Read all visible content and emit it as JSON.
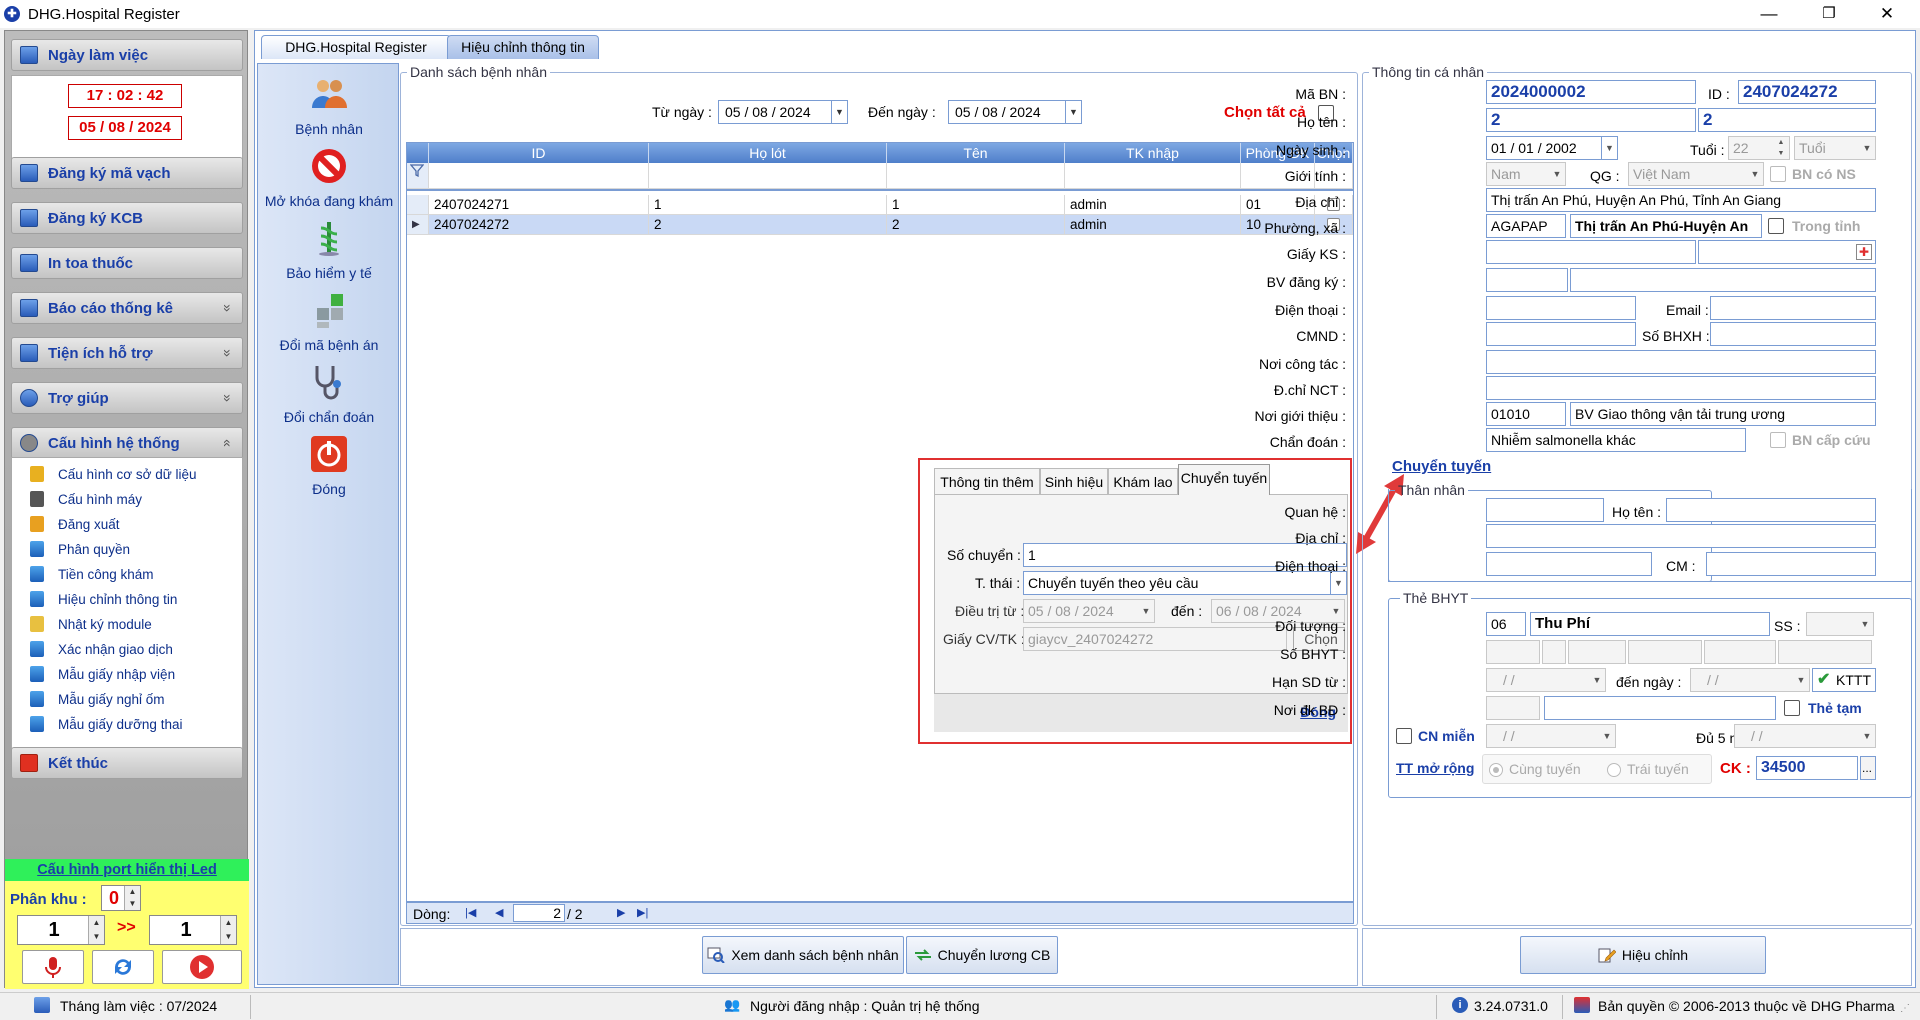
{
  "window": {
    "title": "DHG.Hospital Register",
    "minimize": "—",
    "restore": "❐",
    "close": "✕"
  },
  "sidebar": {
    "ngay_lam_viec": "Ngày làm việc",
    "time": "17 : 02 : 42",
    "date": "05 / 08 / 2024",
    "sections": [
      {
        "label": "Đăng ký mã vạch"
      },
      {
        "label": "Đăng ký KCB"
      },
      {
        "label": "In toa thuốc"
      },
      {
        "label": "Báo cáo thống kê",
        "chev": "»"
      },
      {
        "label": "Tiện ích hỗ trợ",
        "chev": "»"
      },
      {
        "label": "Trợ giúp",
        "chev": "»"
      },
      {
        "label": "Cấu hình hệ thống",
        "chev": "«"
      }
    ],
    "config_items": [
      "Cấu hình cơ sở dữ liệu",
      "Cấu hình máy",
      "Đăng xuất",
      "Phân quyền",
      "Tiền công khám",
      "Hiệu chỉnh thông tin",
      "Nhật ký module",
      "Xác nhận giao dịch",
      "Mẫu giấy nhập viện",
      "Mẫu giấy nghỉ ốm",
      "Mẫu giấy dưỡng thai"
    ],
    "ket_thuc": "Kết thúc",
    "led": {
      "title": "Cấu hình port hiển thị Led",
      "phan_khu_label": "Phân khu :",
      "phan_khu_value": "0",
      "left_value": "1",
      "arrow": ">>",
      "right_value": "1"
    }
  },
  "tabs": [
    "DHG.Hospital Register",
    "Hiệu chỉnh thông tin"
  ],
  "tools": [
    "Bệnh nhân",
    "Mở khóa đang khám",
    "Bảo hiểm y tế",
    "Đổi mã bệnh án",
    "Đổi chẩn đoán",
    "Đóng"
  ],
  "patient_list": {
    "legend": "Danh sách bệnh nhân",
    "tu_ngay_label": "Từ ngày :",
    "tu_ngay": "05 / 08 / 2024",
    "den_ngay_label": "Đến  ngày :",
    "den_ngay": "05 / 08 / 2024",
    "chon_tat_ca": "Chọn tất cả",
    "columns": [
      "ID",
      "Họ lót",
      "Tên",
      "TK nhập",
      "Phòng ĐK",
      "Chọn"
    ],
    "rows": [
      {
        "id": "2407024271",
        "ho_lot": "1",
        "ten": "1",
        "tk": "admin",
        "phong": "01"
      },
      {
        "id": "2407024272",
        "ho_lot": "2",
        "ten": "2",
        "tk": "admin",
        "phong": "10"
      }
    ],
    "footer": {
      "dong_label": "Dòng:",
      "current": "2",
      "total": "/   2"
    },
    "btn_xem": "Xem danh sách bệnh nhân",
    "btn_chuyen": "Chuyển lương CB"
  },
  "popup": {
    "tabs": [
      "Thông tin thêm",
      "Sinh hiệu",
      "Khám lao",
      "Chuyển tuyến"
    ],
    "so_chuyen_label": "Số chuyển :",
    "so_chuyen": "1",
    "t_thai_label": "T. thái :",
    "t_thai": "Chuyển tuyến theo yêu cầu",
    "dieu_tri_tu_label": "Điều trị từ :",
    "dieu_tri_tu": "05 / 08 / 2024",
    "den_label": "đến :",
    "den": "06 / 08 / 2024",
    "giay_label": "Giấy CV/TK :",
    "giay": "giaycv_2407024272",
    "chon": "Chọn",
    "dong": "Đóng"
  },
  "info": {
    "legend": "Thông tin cá nhân",
    "ma_bn_label": "Mã BN :",
    "ma_bn": "2024000002",
    "id_label": "ID :",
    "id": "2407024272",
    "ho_ten_label": "Họ tên :",
    "ho_ten_1": "2",
    "ho_ten_2": "2",
    "ngay_sinh_label": "Ngày sinh :",
    "ngay_sinh": "01 / 01 / 2002",
    "tuoi_label": "Tuổi :",
    "tuoi": "22",
    "tuoi_unit": "Tuổi",
    "gioi_tinh_label": "Giới tính :",
    "gioi_tinh": "Nam",
    "qg_label": "QG :",
    "qg": "Việt Nam",
    "bn_co_ns": "BN có NS",
    "dia_chi_label": "Địa chỉ :",
    "dia_chi": "Thị trấn An Phú, Huyện An Phú, Tỉnh An Giang",
    "phuong_xa_label": "Phường, xã :",
    "phuong_code": "AGAPAP",
    "phuong_name": "Thị trấn An Phú-Huyện An",
    "trong_tinh": "Trong tỉnh",
    "giay_ks_label": "Giấy KS :",
    "bv_dang_ky_label": "BV đăng ký :",
    "dien_thoai_label": "Điện thoại :",
    "email_label": "Email :",
    "cmnd_label": "CMND :",
    "so_bhxh_label": "Số BHXH :",
    "noi_cong_tac_label": "Nơi công tác :",
    "dchi_nct_label": "Đ.chỉ NCT :",
    "noi_gioi_thieu_label": "Nơi giới thiệu :",
    "noi_gt_code": "01010",
    "noi_gt_name": "BV Giao thông vận tải trung ương",
    "chan_doan_label": "Chẩn đoán :",
    "chan_doan": "Nhiễm salmonella khác",
    "bn_cap_cuu": "BN cấp cứu",
    "chuyen_tuyen_link": "Chuyển tuyến"
  },
  "than_nhan": {
    "legend": "Thân nhân",
    "quan_he_label": "Quan hệ :",
    "ho_ten_label": "Họ tên :",
    "dia_chi_label": "Địa chỉ :",
    "dien_thoai_label": "Điện thoại :",
    "cm_label": "CM :"
  },
  "bhyt": {
    "legend": "Thẻ BHYT",
    "doi_tuong_label": "Đối tượng :",
    "doi_tuong_code": "06",
    "doi_tuong_name": "Thu Phí",
    "ss_label": "SS :",
    "so_bhyt_label": "Số BHYT :",
    "han_sd_label": "Hạn SD từ :",
    "den_ngay_label": "đến  ngày :",
    "empty_date": "/     /",
    "kttt": "KTTT",
    "noi_dk_label": "Nơi đk BĐ :",
    "the_tam": "Thẻ tạm",
    "cn_mien": "CN miễn",
    "du_5_nam_label": "Đủ 5 năm :",
    "tt_mo_rong": "TT mở rộng",
    "cung_tuyen": "Cùng tuyến",
    "trai_tuyen": "Trái tuyến",
    "ck_label": "CK :",
    "ck": "34500",
    "ellipsis": "..."
  },
  "hieu_chinh": "Hiệu chỉnh",
  "status": {
    "thang": "Tháng làm việc : 07/2024",
    "user": "Người đăng nhập : Quản trị hệ thống",
    "version": "3.24.0731.0",
    "copyright": "Bản quyền © 2006-2013 thuộc về DHG Pharma"
  },
  "colors": {
    "accent": "#1a3fa8",
    "header_blue": "#4f7fca",
    "red": "#e00000",
    "highlight_row": "#c9d9f5"
  }
}
